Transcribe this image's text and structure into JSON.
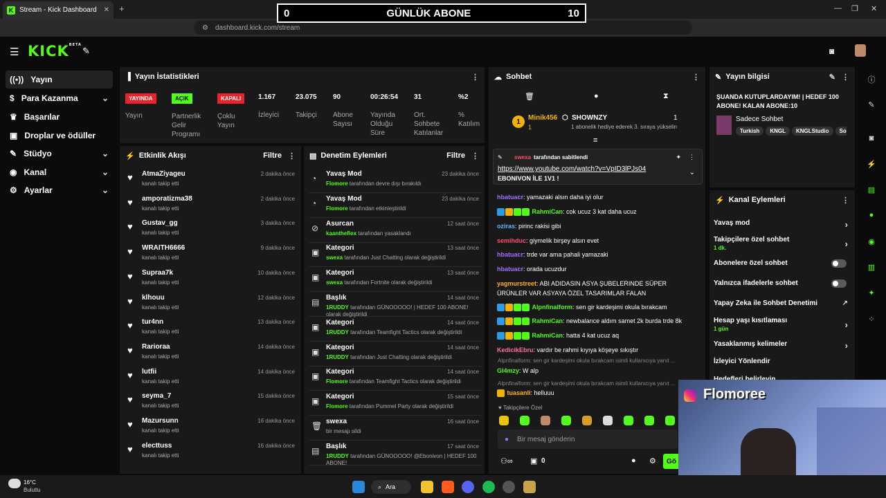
{
  "browser": {
    "tab_title": "Stream - Kick Dashboard",
    "url": "dashboard.kick.com/stream"
  },
  "overlay": {
    "left": "0",
    "title": "GÜNLÜK ABONE",
    "right": "10"
  },
  "sidebar": {
    "items": [
      {
        "label": "Yayın"
      },
      {
        "label": "Para Kazanma"
      },
      {
        "label": "Başarılar"
      },
      {
        "label": "Droplar ve ödüller"
      },
      {
        "label": "Stüdyo"
      },
      {
        "label": "Kanal"
      },
      {
        "label": "Ayarlar"
      }
    ]
  },
  "stats": {
    "title": "Yayın İstatistikleri",
    "badges": [
      {
        "label": "YAYINDA",
        "sub": "Yayın",
        "color": "#e8232d"
      },
      {
        "label": "AÇIK",
        "sub": "Partnerlik Gelir Programı",
        "color": "#53fc18"
      },
      {
        "label": "KAPALI",
        "sub": "Çoklu Yayın",
        "color": "#e8232d"
      }
    ],
    "items": [
      {
        "value": "1.167",
        "label": "İzleyici"
      },
      {
        "value": "23.075",
        "label": "Takipçi"
      },
      {
        "value": "90",
        "label": "Abone Sayısı"
      },
      {
        "value": "00:26:54",
        "label": "Yayında Olduğu Süre"
      },
      {
        "value": "31",
        "label": "Ort. Sohbete Katılanlar"
      },
      {
        "value": "%2",
        "label": "% Katılım"
      }
    ]
  },
  "activity": {
    "title": "Etkinlik Akışı",
    "filter": "Filtre",
    "sub": "kanalı takip etti",
    "rows": [
      {
        "name": "AtmaZiyageu",
        "time": "2 dakika önce"
      },
      {
        "name": "amporatizma38",
        "time": "2 dakika önce"
      },
      {
        "name": "Gustav_gg",
        "time": "3 dakika önce"
      },
      {
        "name": "WRAITH6666",
        "time": "9 dakika önce"
      },
      {
        "name": "Supraa7k",
        "time": "10 dakika önce"
      },
      {
        "name": "klhouu",
        "time": "12 dakika önce"
      },
      {
        "name": "tur4nn",
        "time": "13 dakika önce"
      },
      {
        "name": "Rarioraa",
        "time": "14 dakika önce"
      },
      {
        "name": "lutfii",
        "time": "14 dakika önce"
      },
      {
        "name": "seyma_7",
        "time": "15 dakika önce"
      },
      {
        "name": "Mazursunn",
        "time": "16 dakika önce"
      },
      {
        "name": "electtuss",
        "time": "16 dakika önce"
      }
    ]
  },
  "mod": {
    "title": "Denetim Eylemleri",
    "filter": "Filtre",
    "rows": [
      {
        "icon": "slow-icon",
        "title": "Yavaş Mod",
        "user": "Flomore",
        "text": "tarafından devre dışı bırakıldı",
        "time": "23 dakika önce"
      },
      {
        "icon": "slow-icon",
        "title": "Yavaş Mod",
        "user": "Flomore",
        "text": "tarafından etkinleştirildi",
        "time": "23 dakika önce"
      },
      {
        "icon": "ban-icon",
        "title": "Asurcan",
        "user": "kaantheflex",
        "text": "tarafından yasaklandı",
        "time": "12 saat önce"
      },
      {
        "icon": "category-icon",
        "title": "Kategori",
        "user": "swexa",
        "text": "tarafından Just Chatting olarak değiştirildi",
        "time": "13 saat önce"
      },
      {
        "icon": "category-icon",
        "title": "Kategori",
        "user": "swexa",
        "text": "tarafından Fortnite olarak değiştirildi",
        "time": "13 saat önce"
      },
      {
        "icon": "title-icon",
        "title": "Başlık",
        "user": "1RUDDY",
        "text": "tarafından GÜNOOOOO! | HEDEF 100 ABONE! olarak değiştirildi",
        "time": "14 saat önce"
      },
      {
        "icon": "category-icon",
        "title": "Kategori",
        "user": "1RUDDY",
        "text": "tarafından Teamfight Tactics olarak değiştirildi",
        "time": "14 saat önce"
      },
      {
        "icon": "category-icon",
        "title": "Kategori",
        "user": "1RUDDY",
        "text": "tarafından Just Chatting olarak değiştirildi",
        "time": "14 saat önce"
      },
      {
        "icon": "category-icon",
        "title": "Kategori",
        "user": "Flomore",
        "text": "tarafından Teamfight Tactics olarak değiştirildi",
        "time": "14 saat önce"
      },
      {
        "icon": "category-icon",
        "title": "Kategori",
        "user": "Flomore",
        "text": "tarafından Pummel Party olarak değiştirildi",
        "time": "15 saat önce"
      },
      {
        "icon": "delete-icon",
        "title": "swexa",
        "user": "",
        "text": "bir mesajı sildi",
        "time": "16 saat önce"
      },
      {
        "icon": "title-icon",
        "title": "Başlık",
        "user": "1RUDDY",
        "text": "tarafından GÜNOOOOO! @Ebonivon | HEDEF 100 ABONE!",
        "time": "17 saat önce"
      }
    ]
  },
  "chat": {
    "title": "Sohbet",
    "top_gifter": "Minik456",
    "top_gifter_count": "1",
    "gift_user": "SHOWNZY",
    "gift_count": "1",
    "gift_text": "1 abonelik hediye ederek 3. sıraya yükselin",
    "pinned_by": "swexa",
    "pinned_label": "tarafından sabitlendi",
    "pinned_link": "https://www.youtube.com/watch?v=VpID3lPJs04",
    "pinned_text": "EBONIVON İLE 1V1 !",
    "messages": [
      {
        "user": "hbatuacr",
        "color": "#a36cff",
        "text": "yamazaki alsın daha iyi olur",
        "badges": 0
      },
      {
        "user": "RahmiCan",
        "color": "#53fc18",
        "text": "cok ucuz 3 kat daha ucuz",
        "badges": 4
      },
      {
        "user": "oziras",
        "color": "#5fb6ff",
        "text": "pirinc rakisi gibi",
        "badges": 0
      },
      {
        "user": "semihduc",
        "color": "#ff4d6d",
        "text": "giymelik birşey alsın evet",
        "badges": 0
      },
      {
        "user": "hbatuacr",
        "color": "#a36cff",
        "text": "trde var ama pahali yamazaki",
        "badges": 0
      },
      {
        "user": "hbatuacr",
        "color": "#a36cff",
        "text": "orada ucuzdur",
        "badges": 0
      },
      {
        "user": "yagmurstreet",
        "color": "#ffb020",
        "text": "ABI ADIDASIN ASYA ŞUBELERINDE SÜPER ÜRÜNLER VAR ASYAYA ÖZEL TASARIMLAR FALAN",
        "badges": 0
      },
      {
        "user": "Alpnfinalform",
        "color": "#53fc18",
        "text": "sen gir kardeşimi okula bırakcam",
        "badges": 4
      },
      {
        "user": "RahmiCan",
        "color": "#53fc18",
        "text": "newbalance aldım samet 2k burda trde 8k",
        "badges": 4
      },
      {
        "user": "RahmiCan",
        "color": "#53fc18",
        "text": "hatta 4 kat ucuz aq",
        "badges": 4
      },
      {
        "user": "KedicikEbru",
        "color": "#ff6fa6",
        "text": "vardır be rahmi kıyıya köşeye sıkıştır",
        "badges": 0
      }
    ],
    "reply1": "Alpnfinalform: sen gir kardeşimi okula bırakcam isimli kullanıcıya yanıt ...",
    "msg_gl": {
      "user": "Gl4mzy",
      "text": "W alp"
    },
    "reply2": "Alpnfinalform: sen gir kardeşimi okula bırakcam isimli kullanıcıya yanıt ...",
    "msg_tu": {
      "user": "tuasanli",
      "text": "helluuu"
    },
    "emote_label": "Takipçilere Özel",
    "input_placeholder": "Bir mesaj gönderin",
    "count": "0",
    "send": "Gö"
  },
  "info": {
    "title": "Yayın bilgisi",
    "stream_title": "ŞUANDA KUTUPLARDAYIM! | HEDEF 100 ABONE! KALAN ABONE:10",
    "category": "Sadece Sohbet",
    "tags": [
      "Turkish",
      "KNGL",
      "KNGLStudio",
      "So"
    ]
  },
  "actions": {
    "title": "Kanal Eylemleri",
    "items": [
      {
        "label": "Yavaş mod",
        "sub": "",
        "type": "chevron"
      },
      {
        "label": "Takipçilere özel sohbet",
        "sub": "1 dk.",
        "type": "chevron"
      },
      {
        "label": "Abonelere özel sohbet",
        "sub": "",
        "type": "toggle"
      },
      {
        "label": "Yalnızca ifadelerle sohbet",
        "sub": "",
        "type": "toggle"
      },
      {
        "label": "Yapay Zeka ile Sohbet Denetimi",
        "sub": "",
        "type": "external"
      },
      {
        "label": "Hesap yaşı kısıtlaması",
        "sub": "1 gün",
        "type": "chevron"
      },
      {
        "label": "Yasaklanmış kelimeler",
        "sub": "",
        "type": "chevron"
      },
      {
        "label": "İzleyici Yönlendir",
        "sub": "",
        "type": "none"
      },
      {
        "label": "Hedefleri belirleyin",
        "sub": "",
        "type": "chevron"
      }
    ]
  },
  "webcam": {
    "name": "Flomoree"
  },
  "taskbar": {
    "weather_temp": "16°C",
    "weather_desc": "Bulutlu",
    "search": "Ara"
  }
}
